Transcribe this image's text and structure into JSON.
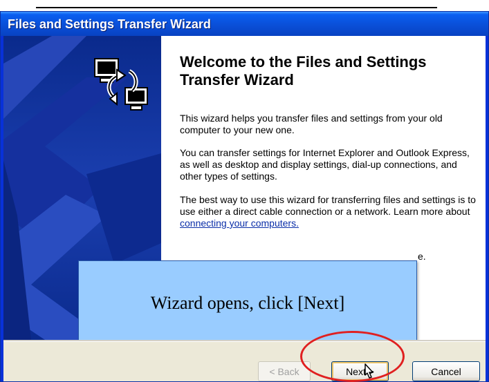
{
  "window": {
    "title": "Files and Settings Transfer Wizard"
  },
  "welcome": {
    "heading": "Welcome to the Files and Settings Transfer Wizard",
    "paragraph1": "This wizard helps you transfer files and settings from your old computer to your new one.",
    "paragraph2": "You can transfer settings for Internet Explorer and Outlook Express, as well as desktop and display settings, dial-up connections, and other types of settings.",
    "paragraph3_text": "The best way to use this wizard for transferring files and settings is to use either a direct cable connection or a network. Learn more about ",
    "paragraph3_link": "connecting your computers.",
    "paragraph4_partial": "e."
  },
  "annotation": {
    "caption": "Wizard opens, click [Next]"
  },
  "buttons": {
    "back": "< Back",
    "next": "Next >",
    "cancel": "Cancel"
  },
  "icons": [
    "wizard-transfer-icon",
    "mouse-cursor-icon"
  ],
  "colors": {
    "titlebar": "#0a4fd8",
    "side_panel": "#1b3fb0",
    "caption_box": "#99ccff",
    "highlight_ellipse": "#e02020",
    "footer": "#ece9d8"
  }
}
